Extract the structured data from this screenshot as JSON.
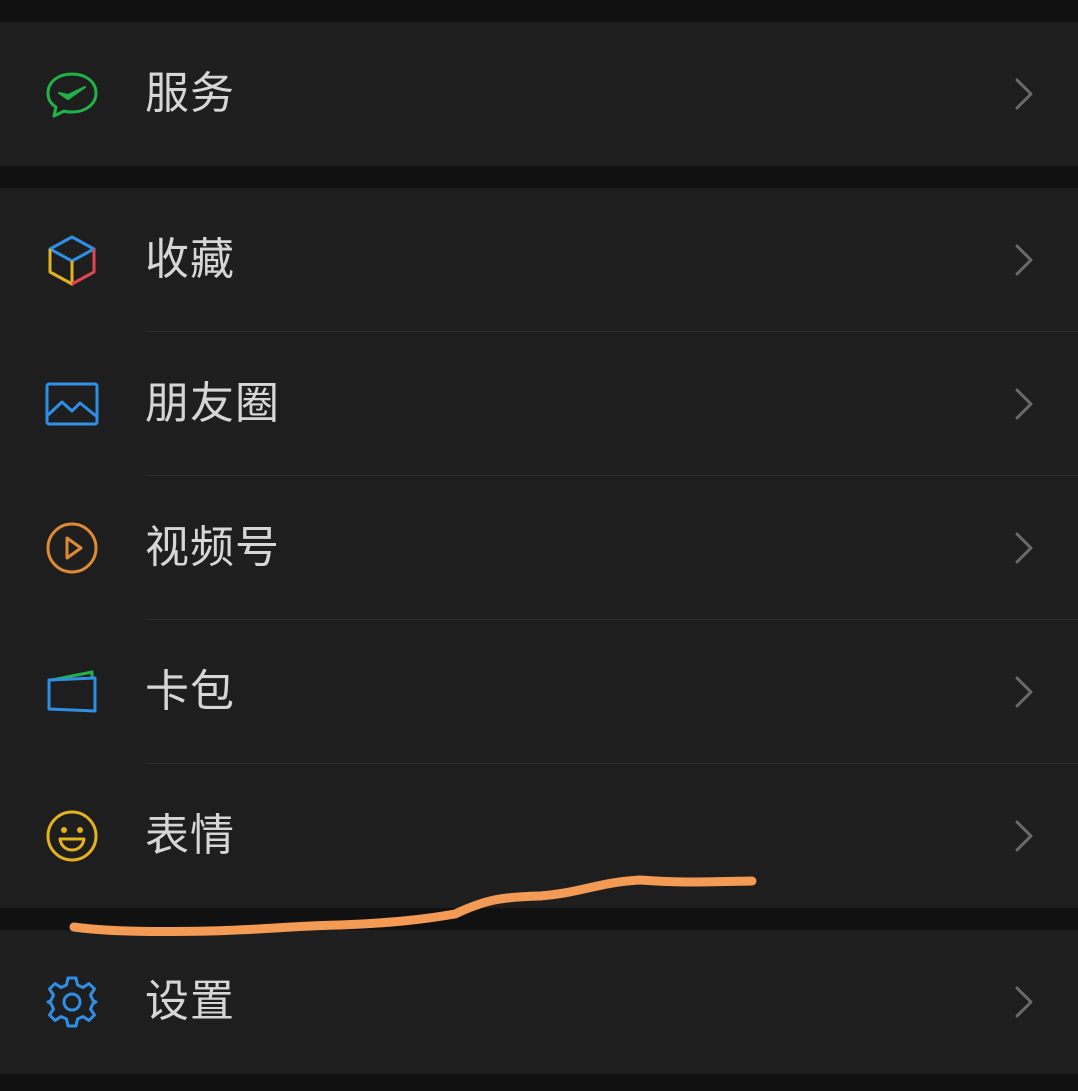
{
  "menu": {
    "groups": [
      {
        "items": [
          {
            "label": "服务",
            "icon": "services-icon",
            "icon_color": "#1fb34a"
          }
        ]
      },
      {
        "items": [
          {
            "label": "收藏",
            "icon": "favorites-cube-icon",
            "icon_color": "#2f8fe6"
          },
          {
            "label": "朋友圈",
            "icon": "moments-image-icon",
            "icon_color": "#2f8fe6"
          },
          {
            "label": "视频号",
            "icon": "channels-play-icon",
            "icon_color": "#e08a35"
          },
          {
            "label": "卡包",
            "icon": "card-wallet-icon",
            "icon_color": "#2f8fe6"
          },
          {
            "label": "表情",
            "icon": "sticker-smile-icon",
            "icon_color": "#e3b21f"
          }
        ]
      },
      {
        "items": [
          {
            "label": "设置",
            "icon": "settings-gear-icon",
            "icon_color": "#2f8fe6"
          }
        ]
      }
    ]
  },
  "colors": {
    "background": "#111111",
    "row_background": "#1e1e1e",
    "text": "#d6d6d6",
    "chevron": "#6a6a6a",
    "annotation_stroke": "#f39a55"
  }
}
